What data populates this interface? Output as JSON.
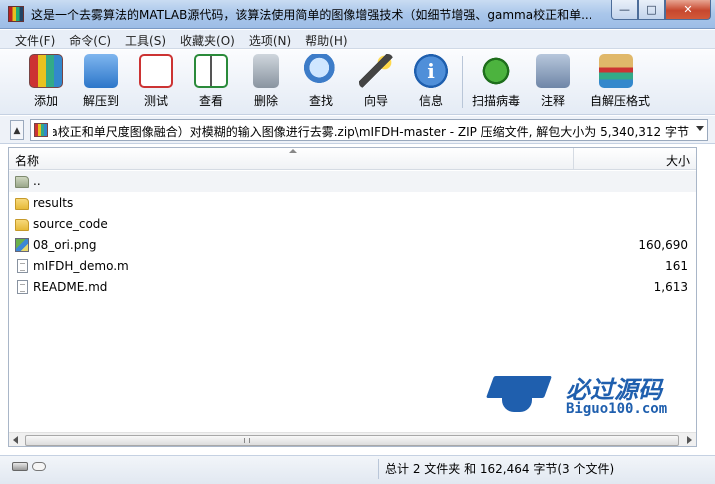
{
  "window": {
    "title": "这是一个去雾算法的MATLAB源代码，该算法使用简单的图像增强技术（如细节增强、gamma校正和单...",
    "min_glyph": "—",
    "max_glyph": "□",
    "close_glyph": "✕"
  },
  "menu": [
    "文件(F)",
    "命令(C)",
    "工具(S)",
    "收藏夹(O)",
    "选项(N)",
    "帮助(H)"
  ],
  "toolbar": [
    {
      "label": "添加",
      "icon": "add-archive-icon"
    },
    {
      "label": "解压到",
      "icon": "extract-to-icon"
    },
    {
      "label": "测试",
      "icon": "test-icon"
    },
    {
      "label": "查看",
      "icon": "view-icon"
    },
    {
      "label": "删除",
      "icon": "delete-icon"
    },
    {
      "label": "查找",
      "icon": "find-icon"
    },
    {
      "label": "向导",
      "icon": "wizard-icon"
    },
    {
      "label": "信息",
      "icon": "info-icon"
    },
    {
      "label": "扫描病毒",
      "icon": "scan-virus-icon"
    },
    {
      "label": "注释",
      "icon": "comment-icon"
    },
    {
      "label": "自解压格式",
      "icon": "sfx-icon"
    }
  ],
  "info_glyph": "i",
  "address": {
    "path": "如细节增强、gamma校正和单尺度图像融合）对模糊的输入图像进行去雾.zip\\mIFDH-master - ZIP 压缩文件, 解包大小为 5,340,312 字节",
    "up_glyph": "▲"
  },
  "columns": {
    "name": "名称",
    "size": "大小"
  },
  "files": [
    {
      "name": "..",
      "size": "",
      "icon": "parent-folder-icon"
    },
    {
      "name": "results",
      "size": "",
      "icon": "folder-icon"
    },
    {
      "name": "source_code",
      "size": "",
      "icon": "folder-icon"
    },
    {
      "name": "08_ori.png",
      "size": "160,690",
      "icon": "png-file-icon"
    },
    {
      "name": "mIFDH_demo.m",
      "size": "161",
      "icon": "file-icon"
    },
    {
      "name": "README.md",
      "size": "1,613",
      "icon": "file-icon"
    }
  ],
  "watermark": {
    "cn": "必过源码",
    "en": "Biguo100.com"
  },
  "status": {
    "summary": "总计 2 文件夹 和 162,464 字节(3 个文件)"
  },
  "colors": {
    "accent": "#1f5fae",
    "titlebar": "#a9c6ea"
  }
}
